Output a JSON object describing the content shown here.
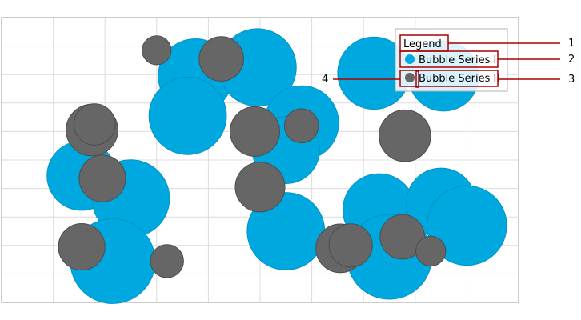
{
  "chart_data": {
    "type": "bubble",
    "title": "",
    "xlabel": "",
    "ylabel": "",
    "xlim": [
      0,
      10
    ],
    "ylim": [
      0,
      10
    ],
    "grid": true,
    "legend": {
      "title": "Legend",
      "placement": "top-right"
    },
    "series": [
      {
        "name": "Bubble Series I",
        "color": "#00a8e0",
        "points": [
          {
            "x": 3.75,
            "y": 7.95,
            "r": 0.72
          },
          {
            "x": 4.95,
            "y": 8.25,
            "r": 0.75
          },
          {
            "x": 3.6,
            "y": 6.55,
            "r": 0.75
          },
          {
            "x": 5.8,
            "y": 6.3,
            "r": 0.72
          },
          {
            "x": 5.5,
            "y": 5.35,
            "r": 0.65
          },
          {
            "x": 7.2,
            "y": 8.05,
            "r": 0.7
          },
          {
            "x": 8.55,
            "y": 7.95,
            "r": 0.68
          },
          {
            "x": 1.55,
            "y": 4.45,
            "r": 0.67
          },
          {
            "x": 2.5,
            "y": 3.65,
            "r": 0.75
          },
          {
            "x": 2.15,
            "y": 1.45,
            "r": 0.82
          },
          {
            "x": 5.5,
            "y": 2.5,
            "r": 0.75
          },
          {
            "x": 7.3,
            "y": 3.25,
            "r": 0.7
          },
          {
            "x": 8.5,
            "y": 3.5,
            "r": 0.67
          },
          {
            "x": 9.0,
            "y": 2.7,
            "r": 0.77
          },
          {
            "x": 7.5,
            "y": 1.6,
            "r": 0.82
          }
        ]
      },
      {
        "name": "Bubble Series II",
        "color": "#666666",
        "points": [
          {
            "x": 3.0,
            "y": 8.85,
            "r": 0.28
          },
          {
            "x": 4.25,
            "y": 8.55,
            "r": 0.43
          },
          {
            "x": 1.75,
            "y": 6.05,
            "r": 0.5
          },
          {
            "x": 1.8,
            "y": 6.25,
            "r": 0.4
          },
          {
            "x": 4.9,
            "y": 6.0,
            "r": 0.48
          },
          {
            "x": 5.8,
            "y": 6.2,
            "r": 0.33
          },
          {
            "x": 7.8,
            "y": 5.85,
            "r": 0.5
          },
          {
            "x": 1.95,
            "y": 4.35,
            "r": 0.45
          },
          {
            "x": 5.0,
            "y": 4.05,
            "r": 0.48
          },
          {
            "x": 1.55,
            "y": 1.95,
            "r": 0.45
          },
          {
            "x": 3.2,
            "y": 1.45,
            "r": 0.32
          },
          {
            "x": 6.55,
            "y": 1.9,
            "r": 0.47
          },
          {
            "x": 6.75,
            "y": 2.0,
            "r": 0.42
          },
          {
            "x": 7.75,
            "y": 2.3,
            "r": 0.43
          },
          {
            "x": 8.3,
            "y": 1.8,
            "r": 0.29
          }
        ]
      }
    ],
    "annotations": [
      {
        "label": "1",
        "target": "legend-title"
      },
      {
        "label": "2",
        "target": "legend-item-1"
      },
      {
        "label": "3",
        "target": "legend-item-2"
      },
      {
        "label": "4",
        "target": "legend-item-2-marker"
      }
    ],
    "annotation_color": "#aa0000"
  }
}
